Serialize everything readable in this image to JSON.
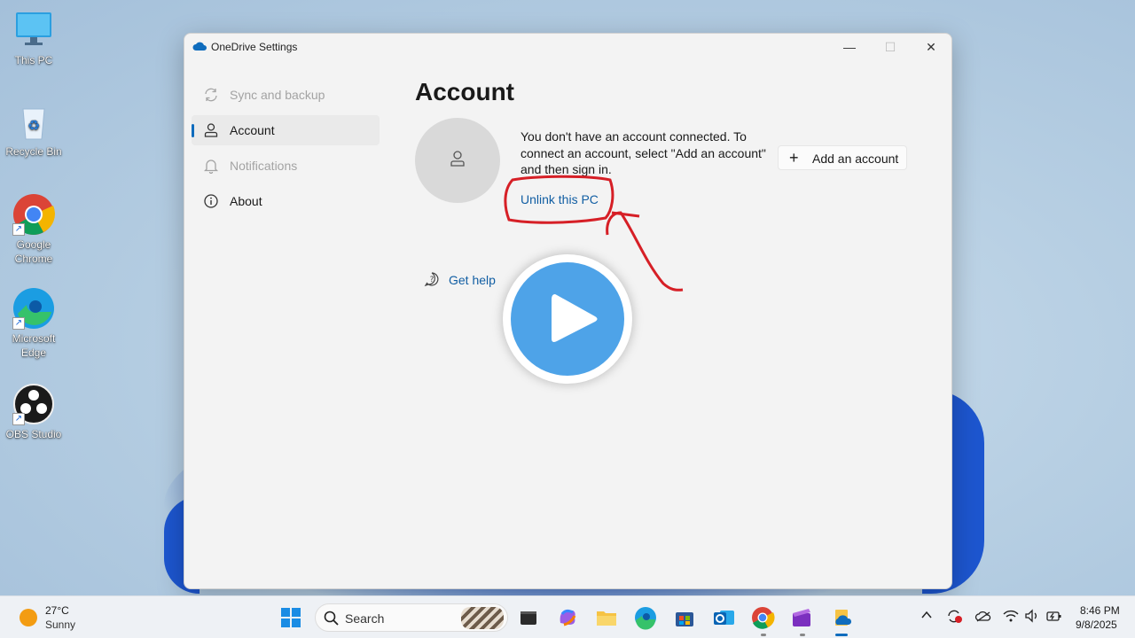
{
  "desktop": {
    "icons": [
      {
        "label": "This PC"
      },
      {
        "label": "Recycle Bin"
      },
      {
        "label": "Google Chrome"
      },
      {
        "label": "Microsoft Edge"
      },
      {
        "label": "OBS Studio"
      }
    ]
  },
  "window": {
    "title": "OneDrive Settings",
    "controls": {
      "minimize": "—",
      "maximize": "☐",
      "close": "✕"
    }
  },
  "nav": {
    "items": [
      {
        "label": "Sync and backup",
        "icon": "sync-icon",
        "state": "disabled"
      },
      {
        "label": "Account",
        "icon": "person-icon",
        "state": "active"
      },
      {
        "label": "Notifications",
        "icon": "bell-icon",
        "state": "disabled"
      },
      {
        "label": "About",
        "icon": "info-icon",
        "state": "normal"
      }
    ]
  },
  "account": {
    "heading": "Account",
    "message": "You don't have an account connected. To connect an account, select \"Add an account\" and then sign in.",
    "add_button": "Add an account",
    "unlink_link": "Unlink this PC",
    "help_link": "Get help"
  },
  "overlay": {
    "play_button": "play-icon",
    "annotation_color": "#d61f26"
  },
  "taskbar": {
    "weather": {
      "temp": "27°C",
      "desc": "Sunny"
    },
    "search_label": "Search",
    "apps": [
      "start-icon",
      "terminal-icon",
      "copilot-icon",
      "file-explorer-icon",
      "edge-icon",
      "store-icon",
      "outlook-icon",
      "chrome-icon",
      "clipchamp-icon",
      "onedrive-icon"
    ],
    "clock": {
      "time": "8:46 PM",
      "date": "9/8/2025"
    }
  },
  "colors": {
    "accent": "#0f6cbd",
    "link": "#115ea3",
    "play": "#4ea3e8"
  }
}
